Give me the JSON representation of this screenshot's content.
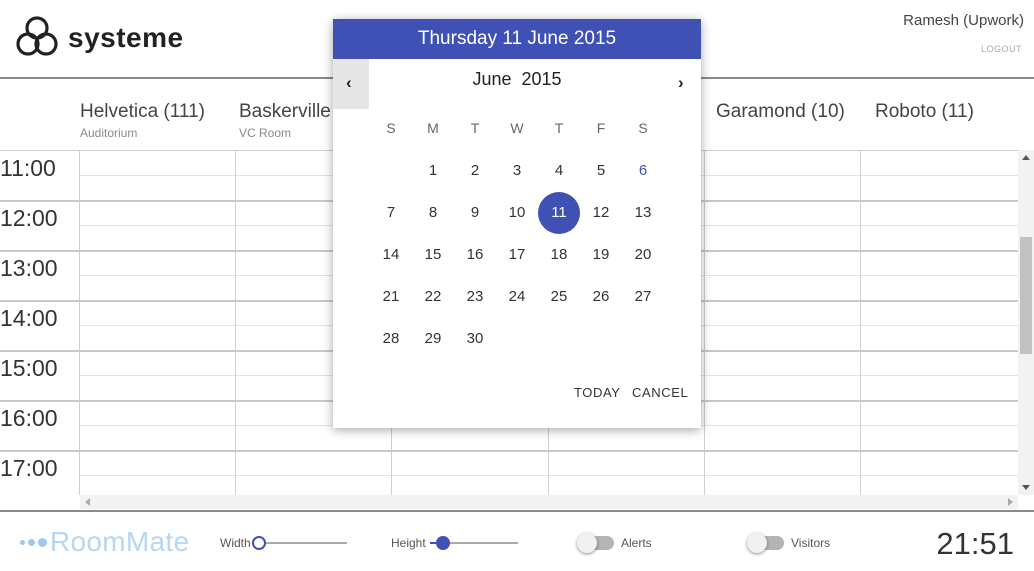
{
  "header": {
    "brand": "systeme",
    "user_name": "Ramesh (Upwork)",
    "logout_label": "LOGOUT"
  },
  "rooms": [
    {
      "name": "Helvetica (111)",
      "sub": "Auditorium"
    },
    {
      "name": "Baskerville",
      "sub": "VC Room"
    },
    {
      "name": "Garamond (10)",
      "sub": ""
    },
    {
      "name": "Roboto (11)",
      "sub": ""
    }
  ],
  "times": [
    "11:00",
    "12:00",
    "13:00",
    "14:00",
    "15:00",
    "16:00",
    "17:00"
  ],
  "datepicker": {
    "header": "Thursday 11 June 2015",
    "month": "June",
    "year": "2015",
    "weekdays": [
      "S",
      "M",
      "T",
      "W",
      "T",
      "F",
      "S"
    ],
    "weeks": [
      [
        "",
        "1",
        "2",
        "3",
        "4",
        "5",
        "6"
      ],
      [
        "7",
        "8",
        "9",
        "10",
        "11",
        "12",
        "13"
      ],
      [
        "14",
        "15",
        "16",
        "17",
        "18",
        "19",
        "20"
      ],
      [
        "21",
        "22",
        "23",
        "24",
        "25",
        "26",
        "27"
      ],
      [
        "28",
        "29",
        "30",
        "",
        "",
        "",
        ""
      ]
    ],
    "selected_day": "11",
    "accent_day": "6",
    "today_label": "TODAY",
    "cancel_label": "CANCEL",
    "accent_color": "#3f51b5"
  },
  "footer": {
    "app_name": "RoomMate",
    "width_label": "Width",
    "width_value": 0,
    "height_label": "Height",
    "height_value": 0.15,
    "alerts_label": "Alerts",
    "alerts_on": false,
    "visitors_label": "Visitors",
    "visitors_on": false,
    "clock": "21:51"
  }
}
